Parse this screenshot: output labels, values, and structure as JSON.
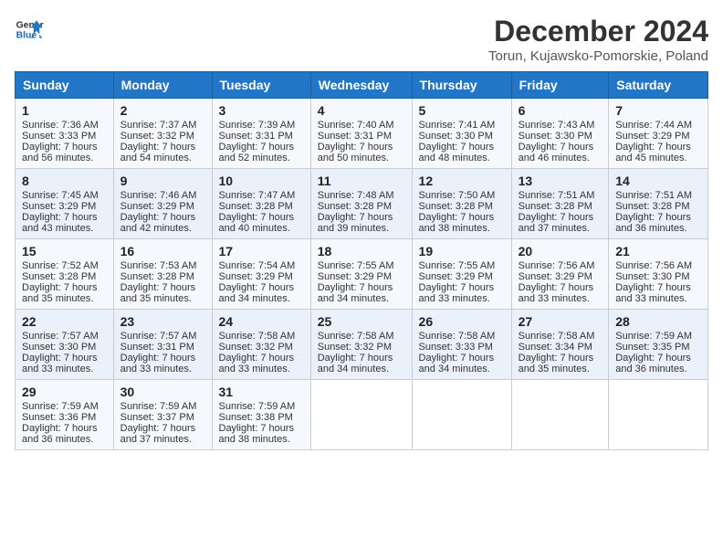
{
  "header": {
    "logo_general": "General",
    "logo_blue": "Blue",
    "title": "December 2024",
    "location": "Torun, Kujawsko-Pomorskie, Poland"
  },
  "days_of_week": [
    "Sunday",
    "Monday",
    "Tuesday",
    "Wednesday",
    "Thursday",
    "Friday",
    "Saturday"
  ],
  "weeks": [
    [
      {
        "day": "1",
        "sunrise": "7:36 AM",
        "sunset": "3:33 PM",
        "daylight": "7 hours and 56 minutes."
      },
      {
        "day": "2",
        "sunrise": "7:37 AM",
        "sunset": "3:32 PM",
        "daylight": "7 hours and 54 minutes."
      },
      {
        "day": "3",
        "sunrise": "7:39 AM",
        "sunset": "3:31 PM",
        "daylight": "7 hours and 52 minutes."
      },
      {
        "day": "4",
        "sunrise": "7:40 AM",
        "sunset": "3:31 PM",
        "daylight": "7 hours and 50 minutes."
      },
      {
        "day": "5",
        "sunrise": "7:41 AM",
        "sunset": "3:30 PM",
        "daylight": "7 hours and 48 minutes."
      },
      {
        "day": "6",
        "sunrise": "7:43 AM",
        "sunset": "3:30 PM",
        "daylight": "7 hours and 46 minutes."
      },
      {
        "day": "7",
        "sunrise": "7:44 AM",
        "sunset": "3:29 PM",
        "daylight": "7 hours and 45 minutes."
      }
    ],
    [
      {
        "day": "8",
        "sunrise": "7:45 AM",
        "sunset": "3:29 PM",
        "daylight": "7 hours and 43 minutes."
      },
      {
        "day": "9",
        "sunrise": "7:46 AM",
        "sunset": "3:29 PM",
        "daylight": "7 hours and 42 minutes."
      },
      {
        "day": "10",
        "sunrise": "7:47 AM",
        "sunset": "3:28 PM",
        "daylight": "7 hours and 40 minutes."
      },
      {
        "day": "11",
        "sunrise": "7:48 AM",
        "sunset": "3:28 PM",
        "daylight": "7 hours and 39 minutes."
      },
      {
        "day": "12",
        "sunrise": "7:50 AM",
        "sunset": "3:28 PM",
        "daylight": "7 hours and 38 minutes."
      },
      {
        "day": "13",
        "sunrise": "7:51 AM",
        "sunset": "3:28 PM",
        "daylight": "7 hours and 37 minutes."
      },
      {
        "day": "14",
        "sunrise": "7:51 AM",
        "sunset": "3:28 PM",
        "daylight": "7 hours and 36 minutes."
      }
    ],
    [
      {
        "day": "15",
        "sunrise": "7:52 AM",
        "sunset": "3:28 PM",
        "daylight": "7 hours and 35 minutes."
      },
      {
        "day": "16",
        "sunrise": "7:53 AM",
        "sunset": "3:28 PM",
        "daylight": "7 hours and 35 minutes."
      },
      {
        "day": "17",
        "sunrise": "7:54 AM",
        "sunset": "3:29 PM",
        "daylight": "7 hours and 34 minutes."
      },
      {
        "day": "18",
        "sunrise": "7:55 AM",
        "sunset": "3:29 PM",
        "daylight": "7 hours and 34 minutes."
      },
      {
        "day": "19",
        "sunrise": "7:55 AM",
        "sunset": "3:29 PM",
        "daylight": "7 hours and 33 minutes."
      },
      {
        "day": "20",
        "sunrise": "7:56 AM",
        "sunset": "3:29 PM",
        "daylight": "7 hours and 33 minutes."
      },
      {
        "day": "21",
        "sunrise": "7:56 AM",
        "sunset": "3:30 PM",
        "daylight": "7 hours and 33 minutes."
      }
    ],
    [
      {
        "day": "22",
        "sunrise": "7:57 AM",
        "sunset": "3:30 PM",
        "daylight": "7 hours and 33 minutes."
      },
      {
        "day": "23",
        "sunrise": "7:57 AM",
        "sunset": "3:31 PM",
        "daylight": "7 hours and 33 minutes."
      },
      {
        "day": "24",
        "sunrise": "7:58 AM",
        "sunset": "3:32 PM",
        "daylight": "7 hours and 33 minutes."
      },
      {
        "day": "25",
        "sunrise": "7:58 AM",
        "sunset": "3:32 PM",
        "daylight": "7 hours and 34 minutes."
      },
      {
        "day": "26",
        "sunrise": "7:58 AM",
        "sunset": "3:33 PM",
        "daylight": "7 hours and 34 minutes."
      },
      {
        "day": "27",
        "sunrise": "7:58 AM",
        "sunset": "3:34 PM",
        "daylight": "7 hours and 35 minutes."
      },
      {
        "day": "28",
        "sunrise": "7:59 AM",
        "sunset": "3:35 PM",
        "daylight": "7 hours and 36 minutes."
      }
    ],
    [
      {
        "day": "29",
        "sunrise": "7:59 AM",
        "sunset": "3:36 PM",
        "daylight": "7 hours and 36 minutes."
      },
      {
        "day": "30",
        "sunrise": "7:59 AM",
        "sunset": "3:37 PM",
        "daylight": "7 hours and 37 minutes."
      },
      {
        "day": "31",
        "sunrise": "7:59 AM",
        "sunset": "3:38 PM",
        "daylight": "7 hours and 38 minutes."
      },
      null,
      null,
      null,
      null
    ]
  ],
  "labels": {
    "sunrise": "Sunrise:",
    "sunset": "Sunset:",
    "daylight": "Daylight:"
  }
}
